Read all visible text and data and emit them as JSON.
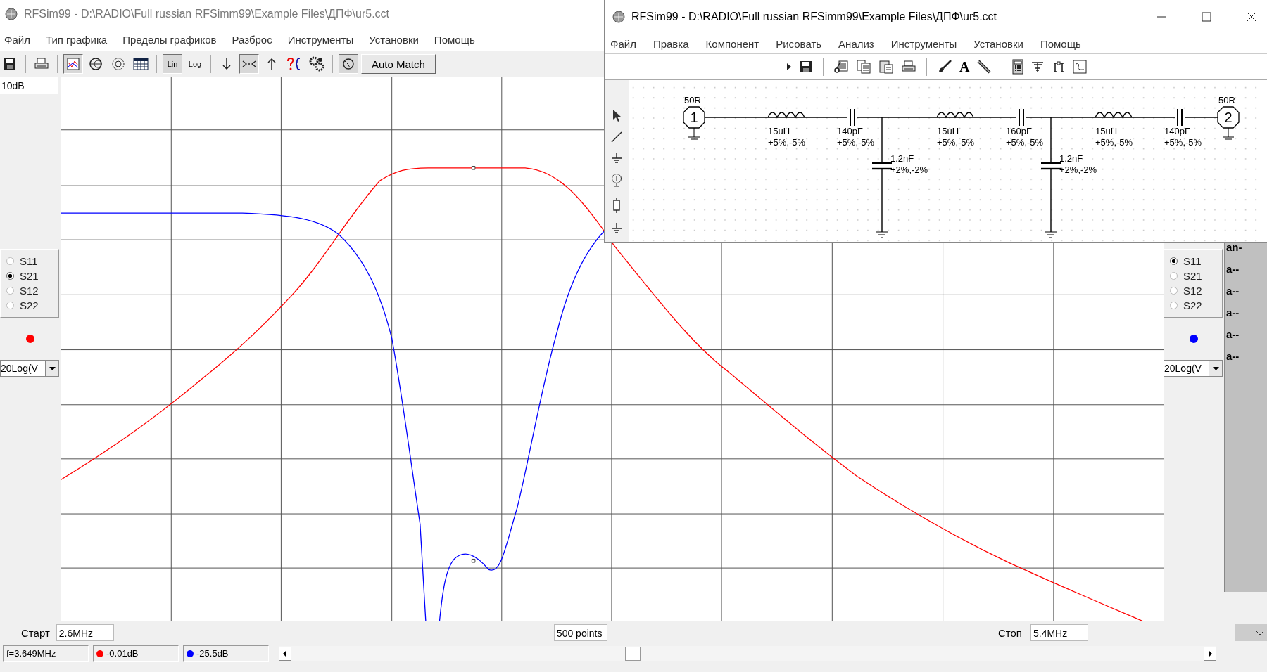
{
  "main_window": {
    "title": "RFSim99 - D:\\RADIO\\Full russian RFSimm99\\Example Files\\ДПФ\\ur5.cct",
    "menu": [
      "Файл",
      "Тип графика",
      "Пределы графиков",
      "Разброс",
      "Инструменты",
      "Установки",
      "Помощь"
    ],
    "toolbar": [
      {
        "kind": "save",
        "pressed": false
      },
      {
        "kind": "sep"
      },
      {
        "kind": "print",
        "pressed": false
      },
      {
        "kind": "sep"
      },
      {
        "kind": "rect-chart",
        "pressed": true
      },
      {
        "kind": "smith",
        "pressed": false
      },
      {
        "kind": "polar",
        "pressed": false
      },
      {
        "kind": "table",
        "pressed": false
      },
      {
        "kind": "sep"
      },
      {
        "kind": "scale",
        "label": "Lin",
        "pressed": true
      },
      {
        "kind": "scale",
        "label": "Log",
        "pressed": false
      },
      {
        "kind": "sep"
      },
      {
        "kind": "down",
        "pressed": false
      },
      {
        "kind": "squeeze",
        "pressed": true
      },
      {
        "kind": "up",
        "pressed": false
      },
      {
        "kind": "help",
        "pressed": false
      },
      {
        "kind": "gears",
        "pressed": false
      },
      {
        "kind": "sep"
      },
      {
        "kind": "match",
        "pressed": true
      },
      {
        "kind": "button",
        "label": "Auto Match"
      }
    ],
    "left_panel": {
      "scale_label": "10dB",
      "params": [
        {
          "label": "S11",
          "selected": false
        },
        {
          "label": "S21",
          "selected": true
        },
        {
          "label": "S12",
          "selected": false
        },
        {
          "label": "S22",
          "selected": false
        }
      ],
      "color": "#ff0000",
      "format": "20Log(V"
    },
    "right_panel": {
      "params": [
        {
          "label": "S11",
          "selected": true
        },
        {
          "label": "S21",
          "selected": false
        },
        {
          "label": "S12",
          "selected": false
        },
        {
          "label": "S22",
          "selected": false
        }
      ],
      "color": "#0000ff",
      "format": "20Log(V"
    },
    "side_strip": [
      "an-",
      "a--",
      "a--",
      "a--",
      "a--",
      "a--"
    ],
    "start": {
      "label": "Старт",
      "value": "2.6MHz"
    },
    "points": "500 points",
    "stop": {
      "label": "Стоп",
      "value": "5.4MHz"
    },
    "status": {
      "frequency": "f=3.649MHz",
      "readings": [
        {
          "color": "#ff0000",
          "value": "-0.01dB"
        },
        {
          "color": "#0000ff",
          "value": "-25.5dB"
        }
      ]
    }
  },
  "schematic_window": {
    "title": "RFSim99 - D:\\RADIO\\Full russian RFSimm99\\Example Files\\ДПФ\\ur5.cct",
    "menu": [
      "Файл",
      "Правка",
      "Компонент",
      "Рисовать",
      "Анализ",
      "Инструменты",
      "Установки",
      "Помощь"
    ],
    "toolbar": [
      {
        "kind": "arrow"
      },
      {
        "kind": "save"
      },
      {
        "kind": "sep"
      },
      {
        "kind": "cut"
      },
      {
        "kind": "copy"
      },
      {
        "kind": "paste"
      },
      {
        "kind": "print"
      },
      {
        "kind": "sep"
      },
      {
        "kind": "brush"
      },
      {
        "kind": "text",
        "label": "A"
      },
      {
        "kind": "pencil"
      },
      {
        "kind": "sep"
      },
      {
        "kind": "calculator"
      },
      {
        "kind": "antenna"
      },
      {
        "kind": "network"
      },
      {
        "kind": "chart"
      }
    ],
    "palette": [
      {
        "kind": "pointer"
      },
      {
        "kind": "wire"
      },
      {
        "kind": "ground"
      },
      {
        "kind": "port"
      },
      {
        "kind": "resistor"
      },
      {
        "kind": "ground"
      }
    ],
    "circuit": [
      {
        "kind": "port",
        "number": "1",
        "value": "50R"
      },
      {
        "kind": "inductor",
        "value": "15uH",
        "tolerance": "+5%,-5%"
      },
      {
        "kind": "capacitor",
        "value": "140pF",
        "tolerance": "+5%,-5%"
      },
      {
        "kind": "shunt_capacitor",
        "value": "1.2nF",
        "tolerance": "+2%,-2%"
      },
      {
        "kind": "inductor",
        "value": "15uH",
        "tolerance": "+5%,-5%"
      },
      {
        "kind": "capacitor",
        "value": "160pF",
        "tolerance": "+5%,-5%"
      },
      {
        "kind": "shunt_capacitor",
        "value": "1.2nF",
        "tolerance": "+2%,-2%"
      },
      {
        "kind": "inductor",
        "value": "15uH",
        "tolerance": "+5%,-5%"
      },
      {
        "kind": "capacitor",
        "value": "140pF",
        "tolerance": "+5%,-5%"
      },
      {
        "kind": "port",
        "number": "2",
        "value": "50R"
      }
    ]
  }
}
